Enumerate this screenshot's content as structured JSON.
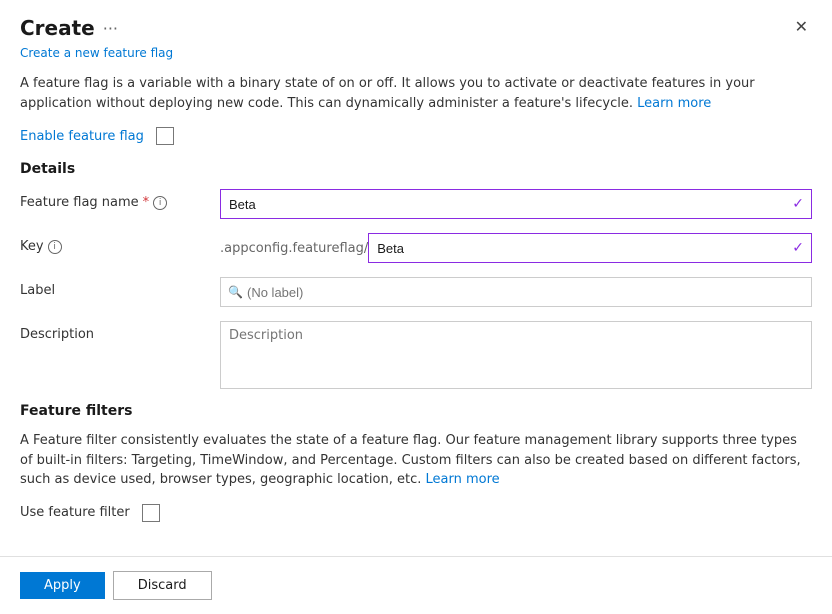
{
  "panel": {
    "title": "Create",
    "more_label": "···",
    "subtitle": "Create a new feature flag",
    "close_label": "✕"
  },
  "description": {
    "text_part1": "A feature flag is a variable with a binary state of on or off. It allows you to activate or deactivate features in your application without deploying new code. This can dynamically administer a feature's lifecycle.",
    "link_text": "Learn more"
  },
  "enable_section": {
    "label": "Enable feature flag"
  },
  "details_section": {
    "title": "Details",
    "name_label": "Feature flag name",
    "name_required": "*",
    "name_value": "Beta",
    "key_label": "Key",
    "key_prefix": ".appconfig.featureflag/",
    "key_value": "Beta",
    "label_label": "Label",
    "label_placeholder": "(No label)",
    "description_label": "Description",
    "description_placeholder": "Description"
  },
  "filters_section": {
    "title": "Feature filters",
    "text_part1": "A Feature filter consistently evaluates the state of a feature flag. Our feature management library supports three types of built-in filters: Targeting, TimeWindow, and Percentage. Custom filters can also be created based on different factors, such as device used, browser types, geographic location, etc.",
    "link_text": "Learn more",
    "use_filter_label": "Use feature filter"
  },
  "footer": {
    "apply_label": "Apply",
    "discard_label": "Discard"
  }
}
